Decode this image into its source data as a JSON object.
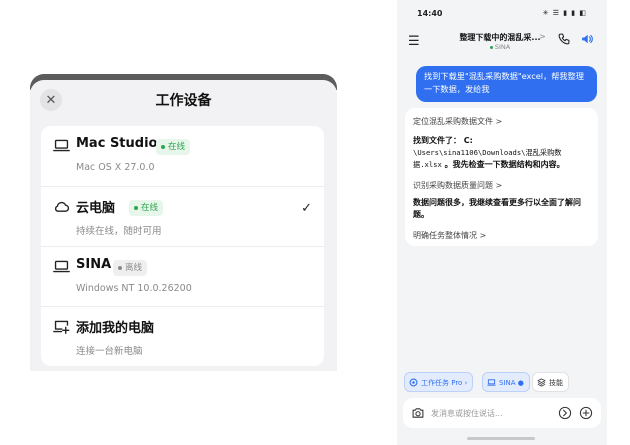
{
  "sheet": {
    "title": "工作设备",
    "close": "✕",
    "devices": [
      {
        "name": "Mac Studio",
        "status": "在线",
        "status_kind": "online",
        "detail": "Mac OS X 27.0.0",
        "icon": "laptop-icon",
        "selected": false
      },
      {
        "name": "云电脑",
        "status": "在线",
        "status_kind": "online",
        "detail": "持续在线，随时可用",
        "icon": "cloud-icon",
        "selected": true
      },
      {
        "name": "SINA",
        "status": "离线",
        "status_kind": "offline",
        "detail": "Windows NT 10.0.26200",
        "icon": "laptop-icon",
        "selected": false
      },
      {
        "name": "添加我的电脑",
        "detail": "连接一台新电脑",
        "icon": "add-computer-icon"
      }
    ],
    "check": "✓"
  },
  "phone": {
    "status_time": "14:40",
    "status_icons": "✳ ☰ ▮ ▮ ◧",
    "nav": {
      "title": "整理下载中的混乱采...",
      "chevron": ">",
      "subtitle": "SINA"
    },
    "user_message": "找到下载里\"混乱采购数据\"excel，帮我整理一下数据，发给我",
    "ai": {
      "step1": "定位混乱采购数据文件 >",
      "found_prefix": "找到文件了：  C:",
      "found_path": "\\Users\\sina1106\\Downloads\\混乱采购数据.xlsx",
      "found_suffix": "。我先检查一下数据结构和内容。",
      "step2": "识别采购数据质量问题 >",
      "issue_text": "数据问题很多，我继续查看更多行以全面了解问题。",
      "step3": "明确任务整体情况 >"
    },
    "chips": [
      {
        "label": "工作任务 Pro ›",
        "kind": "blue"
      },
      {
        "label": "SINA ●",
        "kind": "blue"
      },
      {
        "label": "技能",
        "kind": "plain"
      }
    ],
    "input": {
      "placeholder": "发消息或按住说话..."
    },
    "colors": {
      "accent": "#2f6ff0",
      "online": "#2ea44f"
    }
  }
}
